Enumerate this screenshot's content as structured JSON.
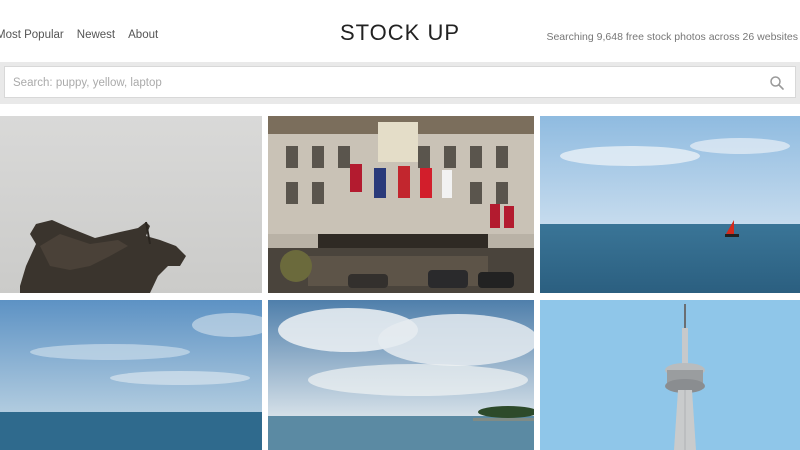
{
  "nav": {
    "items": [
      {
        "label": "Most Popular"
      },
      {
        "label": "Newest"
      },
      {
        "label": "About"
      }
    ]
  },
  "site": {
    "title": "STOCK UP",
    "tagline": "Searching 9,648 free stock photos across 26 websites"
  },
  "search": {
    "placeholder": "Search: puppy, yellow, laptop",
    "value": "",
    "icon": "search-icon"
  },
  "photos": [
    {
      "subject": "statue silhouette"
    },
    {
      "subject": "hotel facade with flags"
    },
    {
      "subject": "lake with red sailboat"
    },
    {
      "subject": "blue sky over lake"
    },
    {
      "subject": "clouds over lake shore"
    },
    {
      "subject": "cn tower"
    }
  ]
}
